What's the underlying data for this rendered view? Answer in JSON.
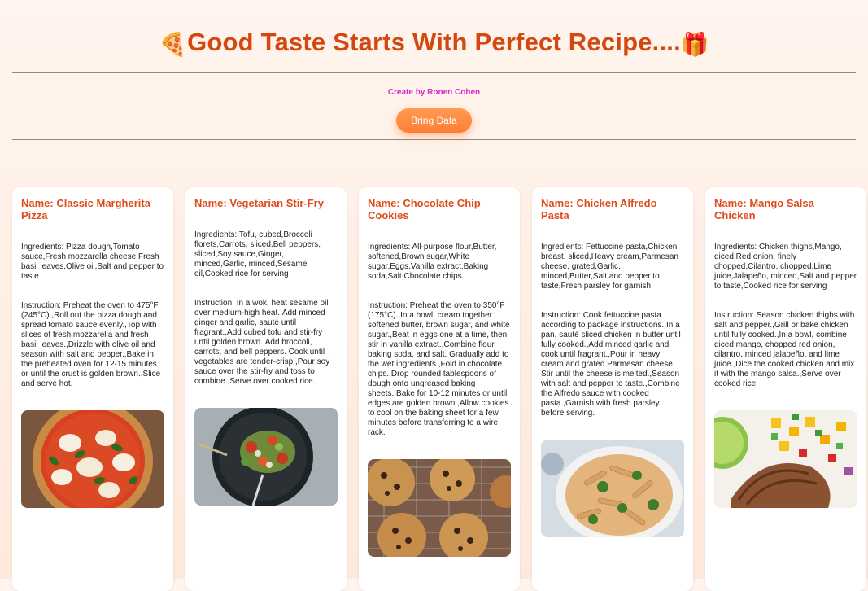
{
  "header": {
    "title": "Good Taste Starts With Perfect Recipe....",
    "emoji_left": "🍕",
    "emoji_right": "🎁",
    "creator": "Create by Ronen Cohen",
    "button_label": "Bring Data"
  },
  "recipes": [
    {
      "title": "Name: Classic Margherita Pizza",
      "ingredients": "Ingredients: Pizza dough,Tomato sauce,Fresh mozzarella cheese,Fresh basil leaves,Olive oil,Salt and pepper to taste",
      "instructions": "Instruction: Preheat the oven to 475°F (245°C).,Roll out the pizza dough and spread tomato sauce evenly.,Top with slices of fresh mozzarella and fresh basil leaves.,Drizzle with olive oil and season with salt and pepper.,Bake in the preheated oven for 12-15 minutes or until the crust is golden brown.,Slice and serve hot.",
      "image_icon": "pizza-photo"
    },
    {
      "title": "Name: Vegetarian Stir-Fry",
      "ingredients": "Ingredients: Tofu, cubed,Broccoli florets,Carrots, sliced,Bell peppers, sliced,Soy sauce,Ginger, minced,Garlic, minced,Sesame oil,Cooked rice for serving",
      "instructions": "Instruction: In a wok, heat sesame oil over medium-high heat.,Add minced ginger and garlic, sauté until fragrant.,Add cubed tofu and stir-fry until golden brown.,Add broccoli, carrots, and bell peppers. Cook until vegetables are tender-crisp.,Pour soy sauce over the stir-fry and toss to combine.,Serve over cooked rice.",
      "image_icon": "stir-fry-photo"
    },
    {
      "title": "Name: Chocolate Chip Cookies",
      "ingredients": "Ingredients: All-purpose flour,Butter, softened,Brown sugar,White sugar,Eggs,Vanilla extract,Baking soda,Salt,Chocolate chips",
      "instructions": "Instruction: Preheat the oven to 350°F (175°C).,In a bowl, cream together softened butter, brown sugar, and white sugar.,Beat in eggs one at a time, then stir in vanilla extract.,Combine flour, baking soda, and salt. Gradually add to the wet ingredients.,Fold in chocolate chips.,Drop rounded tablespoons of dough onto ungreased baking sheets.,Bake for 10-12 minutes or until edges are golden brown.,Allow cookies to cool on the baking sheet for a few minutes before transferring to a wire rack.",
      "image_icon": "cookies-photo"
    },
    {
      "title": "Name: Chicken Alfredo Pasta",
      "ingredients": "Ingredients: Fettuccine pasta,Chicken breast, sliced,Heavy cream,Parmesan cheese, grated,Garlic, minced,Butter,Salt and pepper to taste,Fresh parsley for garnish",
      "instructions": "Instruction: Cook fettuccine pasta according to package instructions.,In a pan, sauté sliced chicken in butter until fully cooked.,Add minced garlic and cook until fragrant.,Pour in heavy cream and grated Parmesan cheese. Stir until the cheese is melted.,Season with salt and pepper to taste.,Combine the Alfredo sauce with cooked pasta.,Garnish with fresh parsley before serving.",
      "image_icon": "pasta-photo"
    },
    {
      "title": "Name: Mango Salsa Chicken",
      "ingredients": "Ingredients: Chicken thighs,Mango, diced,Red onion, finely chopped,Cilantro, chopped,Lime juice,Jalapeño, minced,Salt and pepper to taste,Cooked rice for serving",
      "instructions": "Instruction: Season chicken thighs with salt and pepper.,Grill or bake chicken until fully cooked.,In a bowl, combine diced mango, chopped red onion, cilantro, minced jalapeño, and lime juice.,Dice the cooked chicken and mix it with the mango salsa.,Serve over cooked rice.",
      "image_icon": "mango-chicken-photo"
    }
  ]
}
